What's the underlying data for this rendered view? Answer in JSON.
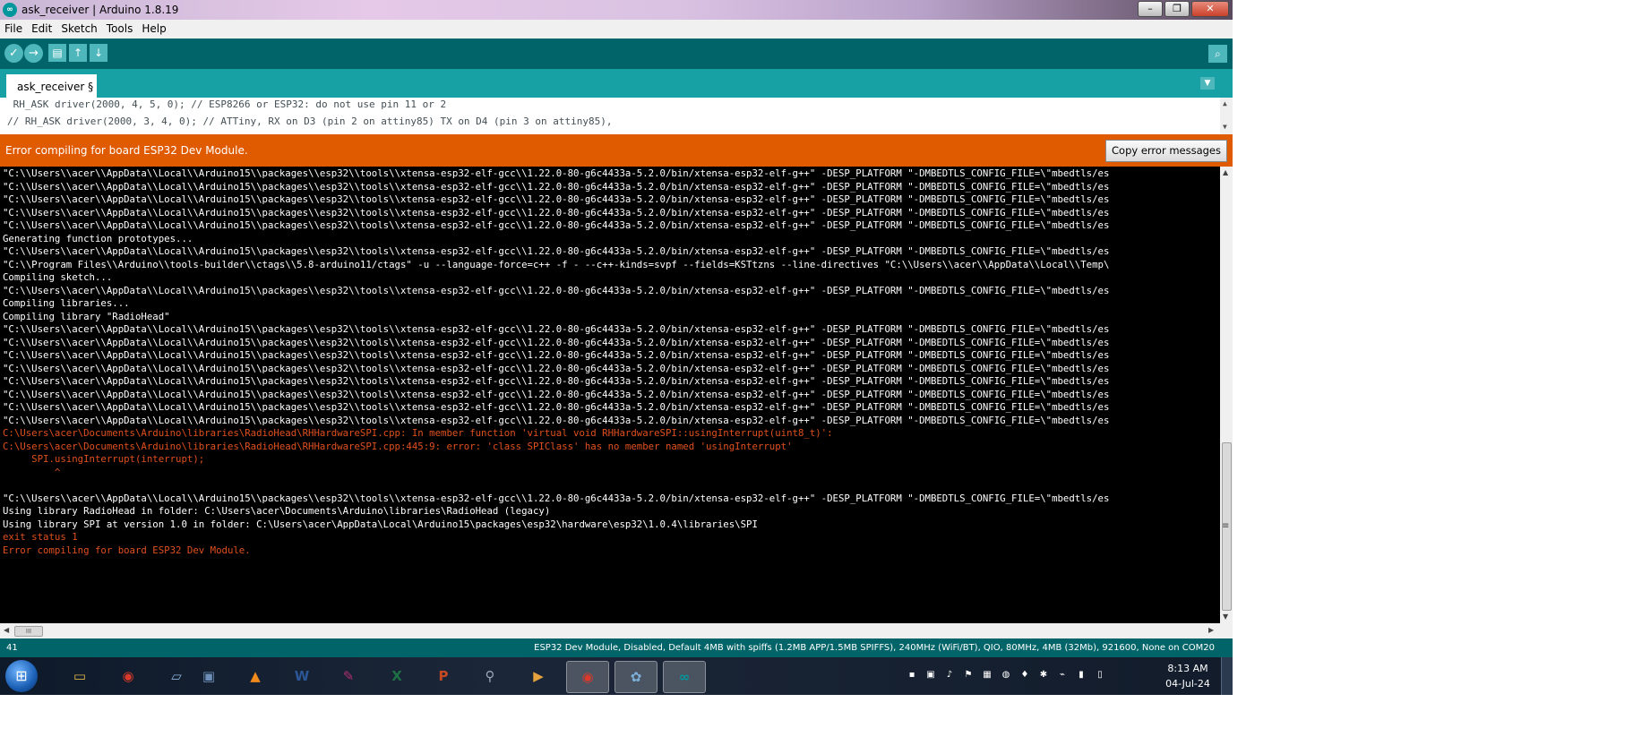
{
  "window": {
    "title": "ask_receiver | Arduino 1.8.19",
    "app_icon_glyph": "∞",
    "controls": [
      "–",
      "❐",
      "✕"
    ]
  },
  "menu": [
    "File",
    "Edit",
    "Sketch",
    "Tools",
    "Help"
  ],
  "toolbar": {
    "verify_icon": "✓",
    "upload_icon": "→",
    "new_icon": "▤",
    "open_icon": "↑",
    "save_icon": "↓",
    "serial_monitor_icon": "⌕"
  },
  "tab": {
    "label": "ask_receiver §",
    "menu_icon": "▼"
  },
  "editor": {
    "lines": [
      " RH_ASK driver(2000, 4, 5, 0); // ESP8266 or ESP32: do not use pin 11 or 2",
      "// RH_ASK driver(2000, 3, 4, 0); // ATTiny, RX on D3 (pin 2 on attiny85) TX on D4 (pin 3 on attiny85),"
    ]
  },
  "error_bar": {
    "message": "Error compiling for board ESP32 Dev Module.",
    "copy_button": "Copy error messages"
  },
  "console": {
    "lines": [
      {
        "text": "\"C:\\\\Users\\\\acer\\\\AppData\\\\Local\\\\Arduino15\\\\packages\\\\esp32\\\\tools\\\\xtensa-esp32-elf-gcc\\\\1.22.0-80-g6c4433a-5.2.0/bin/xtensa-esp32-elf-g++\" -DESP_PLATFORM \"-DMBEDTLS_CONFIG_FILE=\\\"mbedtls/es",
        "err": false
      },
      {
        "text": "\"C:\\\\Users\\\\acer\\\\AppData\\\\Local\\\\Arduino15\\\\packages\\\\esp32\\\\tools\\\\xtensa-esp32-elf-gcc\\\\1.22.0-80-g6c4433a-5.2.0/bin/xtensa-esp32-elf-g++\" -DESP_PLATFORM \"-DMBEDTLS_CONFIG_FILE=\\\"mbedtls/es",
        "err": false
      },
      {
        "text": "\"C:\\\\Users\\\\acer\\\\AppData\\\\Local\\\\Arduino15\\\\packages\\\\esp32\\\\tools\\\\xtensa-esp32-elf-gcc\\\\1.22.0-80-g6c4433a-5.2.0/bin/xtensa-esp32-elf-g++\" -DESP_PLATFORM \"-DMBEDTLS_CONFIG_FILE=\\\"mbedtls/es",
        "err": false
      },
      {
        "text": "\"C:\\\\Users\\\\acer\\\\AppData\\\\Local\\\\Arduino15\\\\packages\\\\esp32\\\\tools\\\\xtensa-esp32-elf-gcc\\\\1.22.0-80-g6c4433a-5.2.0/bin/xtensa-esp32-elf-g++\" -DESP_PLATFORM \"-DMBEDTLS_CONFIG_FILE=\\\"mbedtls/es",
        "err": false
      },
      {
        "text": "\"C:\\\\Users\\\\acer\\\\AppData\\\\Local\\\\Arduino15\\\\packages\\\\esp32\\\\tools\\\\xtensa-esp32-elf-gcc\\\\1.22.0-80-g6c4433a-5.2.0/bin/xtensa-esp32-elf-g++\" -DESP_PLATFORM \"-DMBEDTLS_CONFIG_FILE=\\\"mbedtls/es",
        "err": false
      },
      {
        "text": "Generating function prototypes...",
        "err": false
      },
      {
        "text": "\"C:\\\\Users\\\\acer\\\\AppData\\\\Local\\\\Arduino15\\\\packages\\\\esp32\\\\tools\\\\xtensa-esp32-elf-gcc\\\\1.22.0-80-g6c4433a-5.2.0/bin/xtensa-esp32-elf-g++\" -DESP_PLATFORM \"-DMBEDTLS_CONFIG_FILE=\\\"mbedtls/es",
        "err": false
      },
      {
        "text": "\"C:\\\\Program Files\\\\Arduino\\\\tools-builder\\\\ctags\\\\5.8-arduino11/ctags\" -u --language-force=c++ -f - --c++-kinds=svpf --fields=KSTtzns --line-directives \"C:\\\\Users\\\\acer\\\\AppData\\\\Local\\\\Temp\\",
        "err": false
      },
      {
        "text": "Compiling sketch...",
        "err": false
      },
      {
        "text": "\"C:\\\\Users\\\\acer\\\\AppData\\\\Local\\\\Arduino15\\\\packages\\\\esp32\\\\tools\\\\xtensa-esp32-elf-gcc\\\\1.22.0-80-g6c4433a-5.2.0/bin/xtensa-esp32-elf-g++\" -DESP_PLATFORM \"-DMBEDTLS_CONFIG_FILE=\\\"mbedtls/es",
        "err": false
      },
      {
        "text": "Compiling libraries...",
        "err": false
      },
      {
        "text": "Compiling library \"RadioHead\"",
        "err": false
      },
      {
        "text": "\"C:\\\\Users\\\\acer\\\\AppData\\\\Local\\\\Arduino15\\\\packages\\\\esp32\\\\tools\\\\xtensa-esp32-elf-gcc\\\\1.22.0-80-g6c4433a-5.2.0/bin/xtensa-esp32-elf-g++\" -DESP_PLATFORM \"-DMBEDTLS_CONFIG_FILE=\\\"mbedtls/es",
        "err": false
      },
      {
        "text": "\"C:\\\\Users\\\\acer\\\\AppData\\\\Local\\\\Arduino15\\\\packages\\\\esp32\\\\tools\\\\xtensa-esp32-elf-gcc\\\\1.22.0-80-g6c4433a-5.2.0/bin/xtensa-esp32-elf-g++\" -DESP_PLATFORM \"-DMBEDTLS_CONFIG_FILE=\\\"mbedtls/es",
        "err": false
      },
      {
        "text": "\"C:\\\\Users\\\\acer\\\\AppData\\\\Local\\\\Arduino15\\\\packages\\\\esp32\\\\tools\\\\xtensa-esp32-elf-gcc\\\\1.22.0-80-g6c4433a-5.2.0/bin/xtensa-esp32-elf-g++\" -DESP_PLATFORM \"-DMBEDTLS_CONFIG_FILE=\\\"mbedtls/es",
        "err": false
      },
      {
        "text": "\"C:\\\\Users\\\\acer\\\\AppData\\\\Local\\\\Arduino15\\\\packages\\\\esp32\\\\tools\\\\xtensa-esp32-elf-gcc\\\\1.22.0-80-g6c4433a-5.2.0/bin/xtensa-esp32-elf-g++\" -DESP_PLATFORM \"-DMBEDTLS_CONFIG_FILE=\\\"mbedtls/es",
        "err": false
      },
      {
        "text": "\"C:\\\\Users\\\\acer\\\\AppData\\\\Local\\\\Arduino15\\\\packages\\\\esp32\\\\tools\\\\xtensa-esp32-elf-gcc\\\\1.22.0-80-g6c4433a-5.2.0/bin/xtensa-esp32-elf-g++\" -DESP_PLATFORM \"-DMBEDTLS_CONFIG_FILE=\\\"mbedtls/es",
        "err": false
      },
      {
        "text": "\"C:\\\\Users\\\\acer\\\\AppData\\\\Local\\\\Arduino15\\\\packages\\\\esp32\\\\tools\\\\xtensa-esp32-elf-gcc\\\\1.22.0-80-g6c4433a-5.2.0/bin/xtensa-esp32-elf-g++\" -DESP_PLATFORM \"-DMBEDTLS_CONFIG_FILE=\\\"mbedtls/es",
        "err": false
      },
      {
        "text": "\"C:\\\\Users\\\\acer\\\\AppData\\\\Local\\\\Arduino15\\\\packages\\\\esp32\\\\tools\\\\xtensa-esp32-elf-gcc\\\\1.22.0-80-g6c4433a-5.2.0/bin/xtensa-esp32-elf-g++\" -DESP_PLATFORM \"-DMBEDTLS_CONFIG_FILE=\\\"mbedtls/es",
        "err": false
      },
      {
        "text": "\"C:\\\\Users\\\\acer\\\\AppData\\\\Local\\\\Arduino15\\\\packages\\\\esp32\\\\tools\\\\xtensa-esp32-elf-gcc\\\\1.22.0-80-g6c4433a-5.2.0/bin/xtensa-esp32-elf-g++\" -DESP_PLATFORM \"-DMBEDTLS_CONFIG_FILE=\\\"mbedtls/es",
        "err": false
      },
      {
        "text": "C:\\Users\\acer\\Documents\\Arduino\\libraries\\RadioHead\\RHHardwareSPI.cpp: In member function 'virtual void RHHardwareSPI::usingInterrupt(uint8_t)':",
        "err": true
      },
      {
        "text": "C:\\Users\\acer\\Documents\\Arduino\\libraries\\RadioHead\\RHHardwareSPI.cpp:445:9: error: 'class SPIClass' has no member named 'usingInterrupt'",
        "err": true
      },
      {
        "text": "     SPI.usingInterrupt(interrupt);",
        "err": true
      },
      {
        "text": "         ^",
        "err": true
      },
      {
        "text": "",
        "err": false
      },
      {
        "text": "\"C:\\\\Users\\\\acer\\\\AppData\\\\Local\\\\Arduino15\\\\packages\\\\esp32\\\\tools\\\\xtensa-esp32-elf-gcc\\\\1.22.0-80-g6c4433a-5.2.0/bin/xtensa-esp32-elf-g++\" -DESP_PLATFORM \"-DMBEDTLS_CONFIG_FILE=\\\"mbedtls/es",
        "err": false
      },
      {
        "text": "Using library RadioHead in folder: C:\\Users\\acer\\Documents\\Arduino\\libraries\\RadioHead (legacy)",
        "err": false
      },
      {
        "text": "Using library SPI at version 1.0 in folder: C:\\Users\\acer\\AppData\\Local\\Arduino15\\packages\\esp32\\hardware\\esp32\\1.0.4\\libraries\\SPI",
        "err": false
      },
      {
        "text": "exit status 1",
        "err": true
      },
      {
        "text": "Error compiling for board ESP32 Dev Module.",
        "err": true
      }
    ]
  },
  "scrollbars": {
    "up": "▲",
    "down": "▼",
    "left": "◀",
    "right": "▶",
    "grip_v": "≡",
    "grip_h": "III"
  },
  "status": {
    "line_number": "41",
    "board": "ESP32 Dev Module, Disabled, Default 4MB with spiffs (1.2MB APP/1.5MB SPIFFS), 240MHz (WiFi/BT), QIO, 80MHz, 4MB (32Mb), 921600, None on COM20"
  },
  "taskbar": {
    "start_icon": "⊞",
    "apps": [
      {
        "name": "explorer",
        "glyph": "▭",
        "color": "#e0b54a"
      },
      {
        "name": "chrome",
        "glyph": "◉",
        "color": "#d93a2b"
      },
      {
        "name": "notepad",
        "glyph": "▱",
        "color": "#8fb3d9"
      },
      {
        "name": "desktop",
        "glyph": "▣",
        "color": "#6d8fb8"
      },
      {
        "name": "vlc",
        "glyph": "▲",
        "color": "#f08a1c"
      },
      {
        "name": "word",
        "glyph": "W",
        "color": "#2b5797"
      },
      {
        "name": "powerpoint-pen",
        "glyph": "✎",
        "color": "#b0306e"
      },
      {
        "name": "excel",
        "glyph": "X",
        "color": "#1e7145"
      },
      {
        "name": "presentation",
        "glyph": "P",
        "color": "#c44a24"
      },
      {
        "name": "search-tool",
        "glyph": "⚲",
        "color": "#9aa7b8"
      },
      {
        "name": "media",
        "glyph": "▶",
        "color": "#e6a23c"
      },
      {
        "name": "chrome-2",
        "glyph": "◉",
        "color": "#d93a2b"
      },
      {
        "name": "paint",
        "glyph": "✿",
        "color": "#7cb0d8"
      },
      {
        "name": "arduino",
        "glyph": "∞",
        "color": "#00979c"
      }
    ],
    "tray": [
      "▪",
      "▣",
      "♪",
      "⚑",
      "▦",
      "◍",
      "♦",
      "✱",
      "⌁",
      "▮",
      "▯"
    ],
    "time": "8:13 AM",
    "date": "04-Jul-24"
  }
}
